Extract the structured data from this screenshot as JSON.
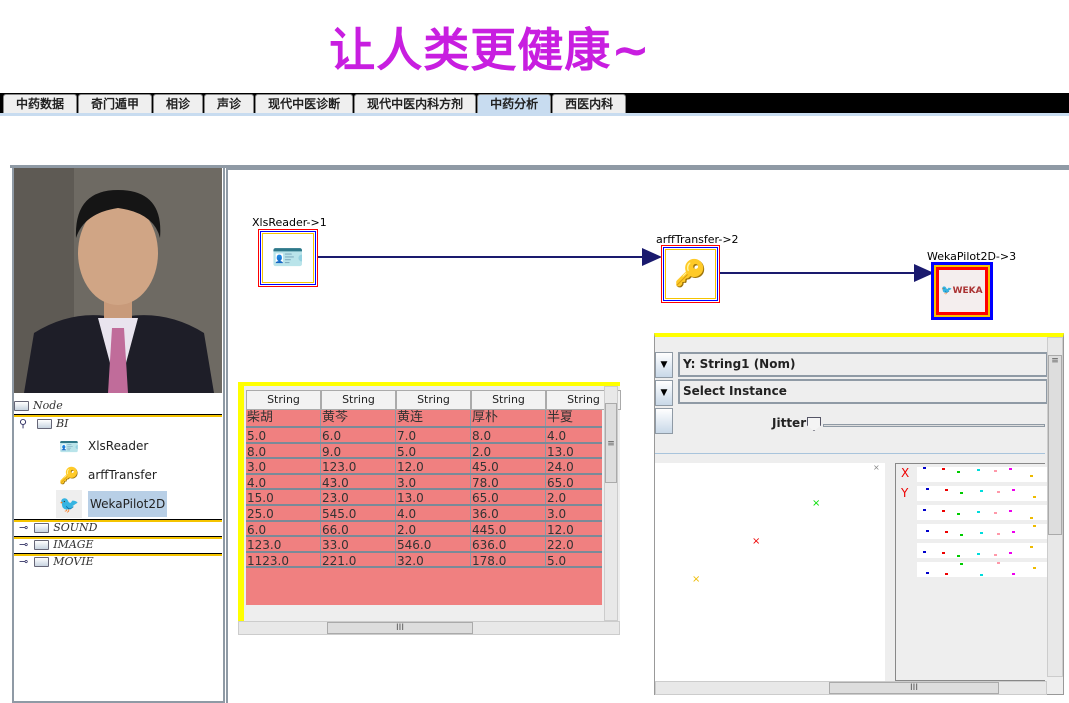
{
  "title": "让人类更健康~",
  "tabs": [
    {
      "label": "中药数据"
    },
    {
      "label": "奇门遁甲"
    },
    {
      "label": "相诊"
    },
    {
      "label": "声诊"
    },
    {
      "label": "现代中医诊断"
    },
    {
      "label": "现代中医内科方剂"
    },
    {
      "label": "中药分析",
      "active": true
    },
    {
      "label": "西医内科"
    }
  ],
  "tree": {
    "root": "Node",
    "groups": [
      "BI",
      "SOUND",
      "IMAGE",
      "MOVIE"
    ],
    "bi_items": [
      {
        "label": "XlsReader",
        "icon": "id-card-icon"
      },
      {
        "label": "arffTransfer",
        "icon": "key-icon"
      },
      {
        "label": "WekaPilot2D",
        "icon": "weka-bird-icon",
        "selected": true
      }
    ]
  },
  "flow": {
    "nodes": [
      {
        "label": "XlsReader->1"
      },
      {
        "label": "arffTransfer->2"
      },
      {
        "label": "WekaPilot2D->3"
      }
    ],
    "connector_color": "#1a1a6e"
  },
  "table": {
    "headers": [
      "String",
      "String",
      "String",
      "String",
      "String"
    ],
    "names": [
      "柴胡",
      "黄芩",
      "黄连",
      "厚朴",
      "半夏"
    ],
    "rows": [
      [
        "5.0",
        "6.0",
        "7.0",
        "8.0",
        "4.0"
      ],
      [
        "8.0",
        "9.0",
        "5.0",
        "2.0",
        "13.0"
      ],
      [
        "3.0",
        "123.0",
        "12.0",
        "45.0",
        "24.0"
      ],
      [
        "4.0",
        "43.0",
        "3.0",
        "78.0",
        "65.0"
      ],
      [
        "15.0",
        "23.0",
        "13.0",
        "65.0",
        "2.0"
      ],
      [
        "25.0",
        "545.0",
        "4.0",
        "36.0",
        "3.0"
      ],
      [
        "6.0",
        "66.0",
        "2.0",
        "445.0",
        "12.0"
      ],
      [
        "123.0",
        "33.0",
        "546.0",
        "636.0",
        "22.0"
      ],
      [
        "1123.0",
        "221.0",
        "32.0",
        "178.0",
        "5.0"
      ]
    ],
    "row_color": "#f08080",
    "hscroll_grip": "III"
  },
  "weka": {
    "y_axis": "Y: String1 (Nom)",
    "select_instance": "Select Instance",
    "jitter_label": "Jitter",
    "jitter_value": 0,
    "legend_x": "X",
    "legend_y": "Y",
    "hscroll_grip": "III"
  }
}
